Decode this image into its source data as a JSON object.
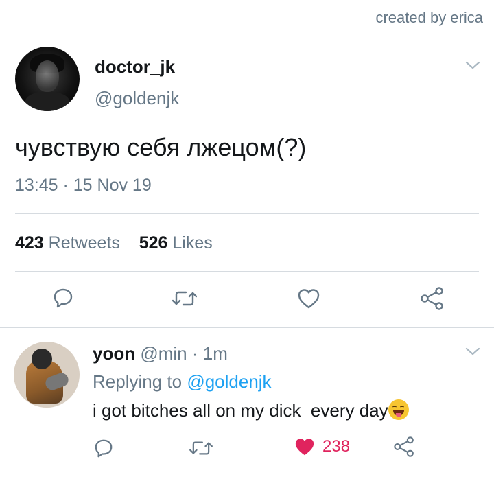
{
  "credit": "created by erica",
  "tweet": {
    "author_name": "doctor_jk",
    "author_handle": "@goldenjk",
    "text": "чувствую себя лжецом(?)",
    "timestamp": "13:45 · 15 Nov 19",
    "stats": {
      "retweets_count": "423",
      "retweets_label": "Retweets",
      "likes_count": "526",
      "likes_label": "Likes"
    },
    "actions": [
      "reply-icon",
      "retweet-icon",
      "like-icon",
      "share-icon"
    ]
  },
  "reply": {
    "author_name": "yoon",
    "author_handle": "@min",
    "separator": "·",
    "time": "1m",
    "replying_prefix": "Replying to",
    "replying_to": "@goldenjk",
    "text": "i got bitches all on my dick  every day",
    "emoji": "drooling-face",
    "like_count": "238",
    "liked": true
  },
  "colors": {
    "text_primary": "#14171a",
    "text_secondary": "#657786",
    "link": "#1da1f2",
    "like": "#e0245e",
    "divider": "#d6dbe0"
  }
}
